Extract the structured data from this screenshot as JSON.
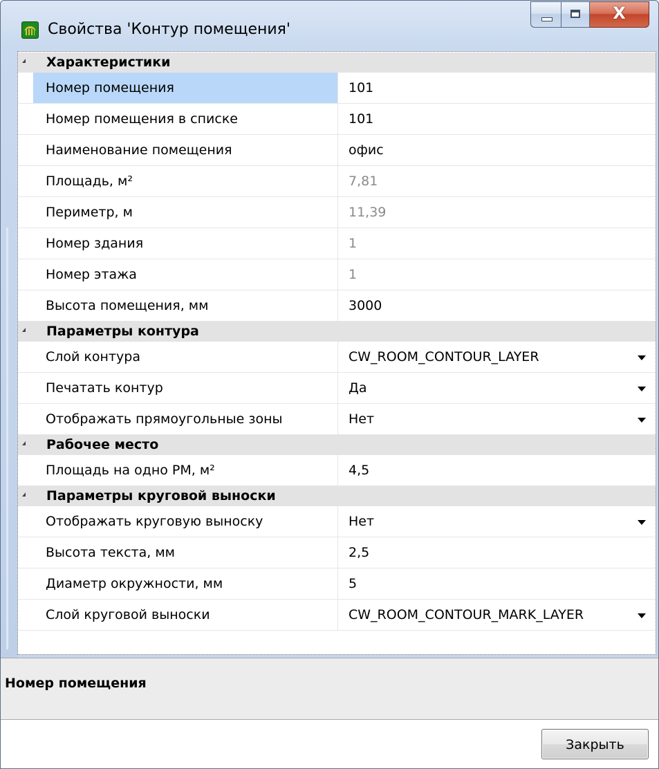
{
  "window": {
    "title": "Свойства 'Контур помещения'",
    "buttons": {
      "minimize": "minimize",
      "maximize": "maximize",
      "close_glyph": "X"
    }
  },
  "grid": {
    "categories": [
      {
        "label": "Характеристики",
        "rows": [
          {
            "name": "Номер помещения",
            "value": "101",
            "readonly": false,
            "dropdown": false,
            "selected": true
          },
          {
            "name": "Номер помещения в списке",
            "value": "101",
            "readonly": false,
            "dropdown": false
          },
          {
            "name": "Наименование помещения",
            "value": "офис",
            "readonly": false,
            "dropdown": false
          },
          {
            "name": "Площадь, м²",
            "value": "7,81",
            "readonly": true,
            "dropdown": false
          },
          {
            "name": "Периметр, м",
            "value": "11,39",
            "readonly": true,
            "dropdown": false
          },
          {
            "name": "Номер здания",
            "value": "1",
            "readonly": true,
            "dropdown": false
          },
          {
            "name": "Номер этажа",
            "value": "1",
            "readonly": true,
            "dropdown": false
          },
          {
            "name": "Высота помещения, мм",
            "value": "3000",
            "readonly": false,
            "dropdown": false
          }
        ]
      },
      {
        "label": "Параметры контура",
        "rows": [
          {
            "name": "Слой контура",
            "value": "CW_ROOM_CONTOUR_LAYER",
            "readonly": false,
            "dropdown": true
          },
          {
            "name": "Печатать контур",
            "value": "Да",
            "readonly": false,
            "dropdown": true
          },
          {
            "name": "Отображать прямоугольные зоны",
            "value": "Нет",
            "readonly": false,
            "dropdown": true
          }
        ]
      },
      {
        "label": "Рабочее место",
        "rows": [
          {
            "name": "Площадь на одно РМ, м²",
            "value": "4,5",
            "readonly": false,
            "dropdown": false
          }
        ]
      },
      {
        "label": "Параметры круговой выноски",
        "rows": [
          {
            "name": "Отображать круговую выноску",
            "value": "Нет",
            "readonly": false,
            "dropdown": true
          },
          {
            "name": "Высота текста, мм",
            "value": "2,5",
            "readonly": false,
            "dropdown": false
          },
          {
            "name": "Диаметр окружности, мм",
            "value": "5",
            "readonly": false,
            "dropdown": false
          },
          {
            "name": "Слой круговой выноски",
            "value": "CW_ROOM_CONTOUR_MARK_LAYER",
            "readonly": false,
            "dropdown": true
          }
        ]
      }
    ]
  },
  "description": {
    "title": "Номер помещения"
  },
  "footer": {
    "close_label": "Закрыть"
  },
  "colors": {
    "selection": "#b9d8f9",
    "category_bg": "#e3e3e3",
    "readonly_text": "#8a8a8a"
  }
}
